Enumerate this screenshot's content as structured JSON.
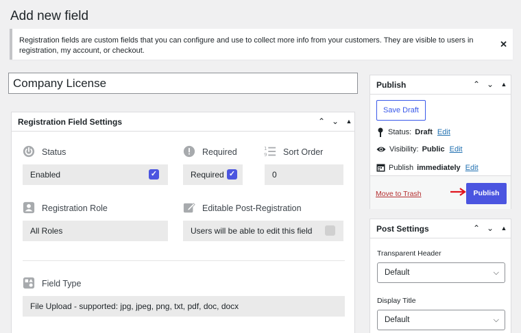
{
  "page": {
    "title": "Add new field",
    "notice": "Registration fields are custom fields that you can configure and use to collect more info from your customers. They are visible to users in registration, my account, or checkout.",
    "field_title_value": "Company License"
  },
  "settings": {
    "title": "Registration Field Settings",
    "status": {
      "label": "Status",
      "value": "Enabled",
      "checked": true
    },
    "required": {
      "label": "Required",
      "value": "Required",
      "checked": true
    },
    "sort_order": {
      "label": "Sort Order",
      "value": "0"
    },
    "role": {
      "label": "Registration Role",
      "value": "All Roles"
    },
    "editable": {
      "label": "Editable Post-Registration",
      "value": "Users will be able to edit this field",
      "checked": false
    },
    "field_type": {
      "label": "Field Type",
      "value": "File Upload - supported: jpg, jpeg, png, txt, pdf, doc, docx"
    }
  },
  "publish": {
    "title": "Publish",
    "save_draft": "Save Draft",
    "status_label": "Status:",
    "status_value": "Draft",
    "visibility_label": "Visibility:",
    "visibility_value": "Public",
    "publish_label": "Publish",
    "publish_value": "immediately",
    "edit": "Edit",
    "trash": "Move to Trash",
    "publish_button": "Publish"
  },
  "post_settings": {
    "title": "Post Settings",
    "transparent_header_label": "Transparent Header",
    "transparent_header_value": "Default",
    "display_title_label": "Display Title",
    "display_title_value": "Default"
  },
  "colors": {
    "accent": "#4b55e0",
    "link": "#2271b1",
    "danger": "#b32d2e",
    "arrow": "#e0141e"
  }
}
